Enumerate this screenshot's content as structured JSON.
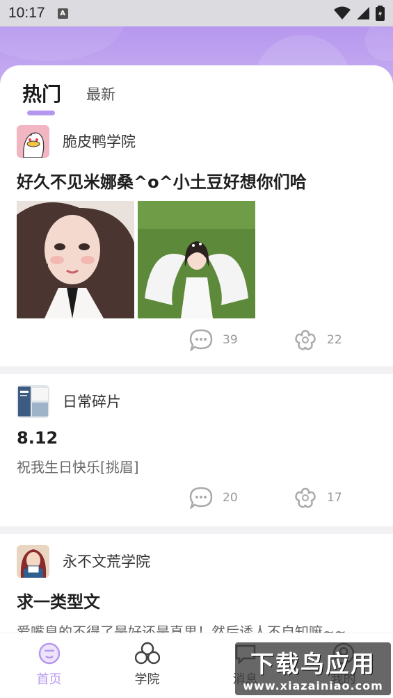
{
  "status_bar": {
    "time": "10:17",
    "badge": "A"
  },
  "tabs": [
    {
      "label": "热门",
      "active": true
    },
    {
      "label": "最新",
      "active": false
    }
  ],
  "posts": [
    {
      "author": "脆皮鸭学院",
      "title": "好久不见米娜桑^o^小土豆好想你们哈",
      "body": "",
      "comments": "39",
      "likes": "22"
    },
    {
      "author": "日常碎片",
      "title": "8.12",
      "body": "祝我生日快乐[挑眉]",
      "comments": "20",
      "likes": "17"
    },
    {
      "author": "永不文荒学院",
      "title": "求一类型文",
      "body": "爱嘴臭的不得了是好还是真男！然后诱人不自知嘛~~"
    }
  ],
  "bottom_nav": [
    {
      "label": "首页",
      "icon": "home-face-icon",
      "active": true
    },
    {
      "label": "学院",
      "icon": "college-icon",
      "active": false
    },
    {
      "label": "消息",
      "icon": "message-icon",
      "active": false
    },
    {
      "label": "我的",
      "icon": "profile-icon",
      "active": false
    }
  ],
  "watermark": {
    "main": "下载鸟应用",
    "sub": "www.xiazainiao.com"
  },
  "colors": {
    "accent": "#b697ee",
    "header_top": "#b697ee",
    "header_bottom": "#c9b1f3",
    "gray_text": "#999999"
  }
}
